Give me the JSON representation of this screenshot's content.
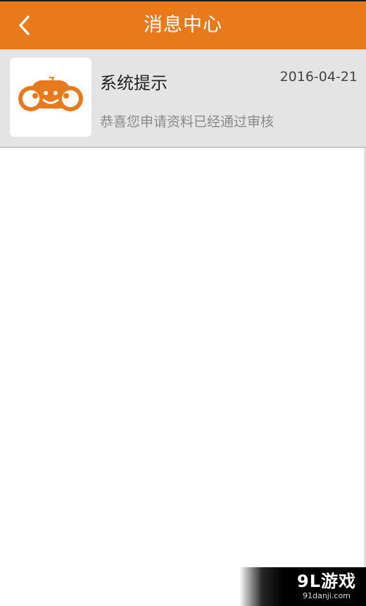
{
  "header": {
    "title": "消息中心",
    "back_icon": "chevron-left-icon"
  },
  "messages": [
    {
      "title": "系统提示",
      "date": "2016-04-21",
      "body": "恭喜您申请资料已经通过审核",
      "icon": "car-mascot-icon"
    }
  ],
  "watermark": {
    "main": "9L游戏",
    "sub": "91danji.com"
  },
  "colors": {
    "accent": "#e87a1c",
    "list_bg": "#e4e4e4"
  }
}
